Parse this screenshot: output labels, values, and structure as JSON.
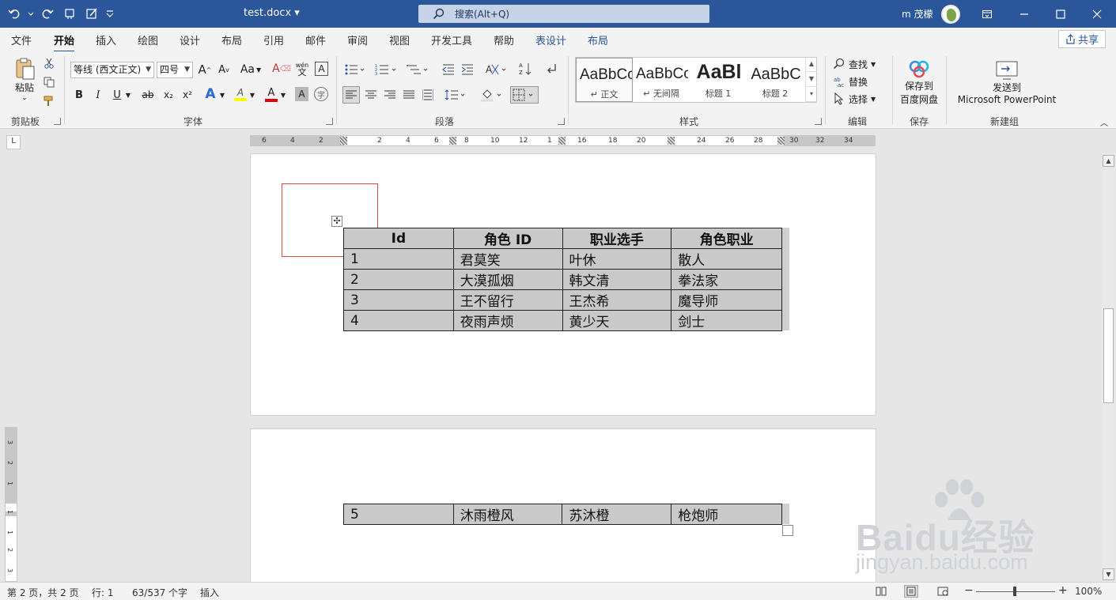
{
  "titlebar": {
    "doc_title": "test.docx ▾",
    "search_placeholder": "搜索(Alt+Q)",
    "user_name": "m 茂檬"
  },
  "menu": {
    "tabs": [
      "文件",
      "开始",
      "插入",
      "绘图",
      "设计",
      "布局",
      "引用",
      "邮件",
      "审阅",
      "视图",
      "开发工具",
      "帮助",
      "表设计",
      "布局"
    ],
    "active_tab": "开始",
    "share": "共享"
  },
  "ribbon": {
    "clipboard": {
      "label": "剪贴板",
      "paste": "粘贴"
    },
    "font": {
      "label": "字体",
      "font_name": "等线 (西文正文)",
      "font_size": "四号",
      "aa": "Aa",
      "bold": "B",
      "italic": "I",
      "underline": "U",
      "strike": "ab",
      "subscript": "x₂",
      "superscript": "x²",
      "phonetic_top": "wén",
      "phonetic_bottom": "文",
      "boxed": "A",
      "highlight": "A",
      "text_effect": "A",
      "font_color": "A",
      "char_shading": "A",
      "circle_char": "字"
    },
    "paragraph": {
      "label": "段落"
    },
    "styles": {
      "label": "样式",
      "items": [
        {
          "sample": "AaBbCcI",
          "name": "↵ 正文"
        },
        {
          "sample": "AaBbCcI",
          "name": "↵ 无间隔"
        },
        {
          "sample": "AaBl",
          "name": "标题 1"
        },
        {
          "sample": "AaBbC",
          "name": "标题 2"
        }
      ]
    },
    "editing": {
      "label": "编辑",
      "find": "查找",
      "replace": "替换",
      "select": "选择"
    },
    "save": {
      "label": "保存",
      "button_line1": "保存到",
      "button_line2": "百度网盘"
    },
    "newgroup": {
      "label": "新建组",
      "button_line1": "发送到",
      "button_line2": "Microsoft PowerPoint"
    }
  },
  "ruler": {
    "corner": "L",
    "labels": [
      "6",
      "4",
      "2",
      "2",
      "4",
      "6",
      "8",
      "10",
      "12",
      "1",
      "16",
      "18",
      "20",
      "24",
      "26",
      "28",
      "30",
      "32",
      "34"
    ],
    "vertical_labels": [
      "3",
      "2",
      "1",
      "1",
      "1",
      "2",
      "3"
    ]
  },
  "document": {
    "headers": [
      "Id",
      "角色 ID",
      "职业选手",
      "角色职业"
    ],
    "rows_page1": [
      [
        "1",
        "君莫笑",
        "叶休",
        "散人"
      ],
      [
        "2",
        "大漠孤烟",
        "韩文清",
        "拳法家"
      ],
      [
        "3",
        "王不留行",
        "王杰希",
        "魔导师"
      ],
      [
        "4",
        "夜雨声烦",
        "黄少天",
        "剑士"
      ]
    ],
    "rows_page2": [
      [
        "5",
        "沐雨橙风",
        "苏沐橙",
        "枪炮师"
      ]
    ],
    "move_handle": "✣"
  },
  "statusbar": {
    "page": "第 2 页，共 2 页",
    "line": "行: 1",
    "words": "63/537 个字",
    "mode": "插入",
    "zoom": "100%",
    "minus": "−",
    "plus": "+"
  },
  "watermark": {
    "brand": "Baidu经验",
    "url": "jingyan.baidu.com"
  },
  "colors": {
    "titlebar": "#2b579a",
    "table_fill": "#c9c9c9",
    "selection_box": "#e04848"
  }
}
